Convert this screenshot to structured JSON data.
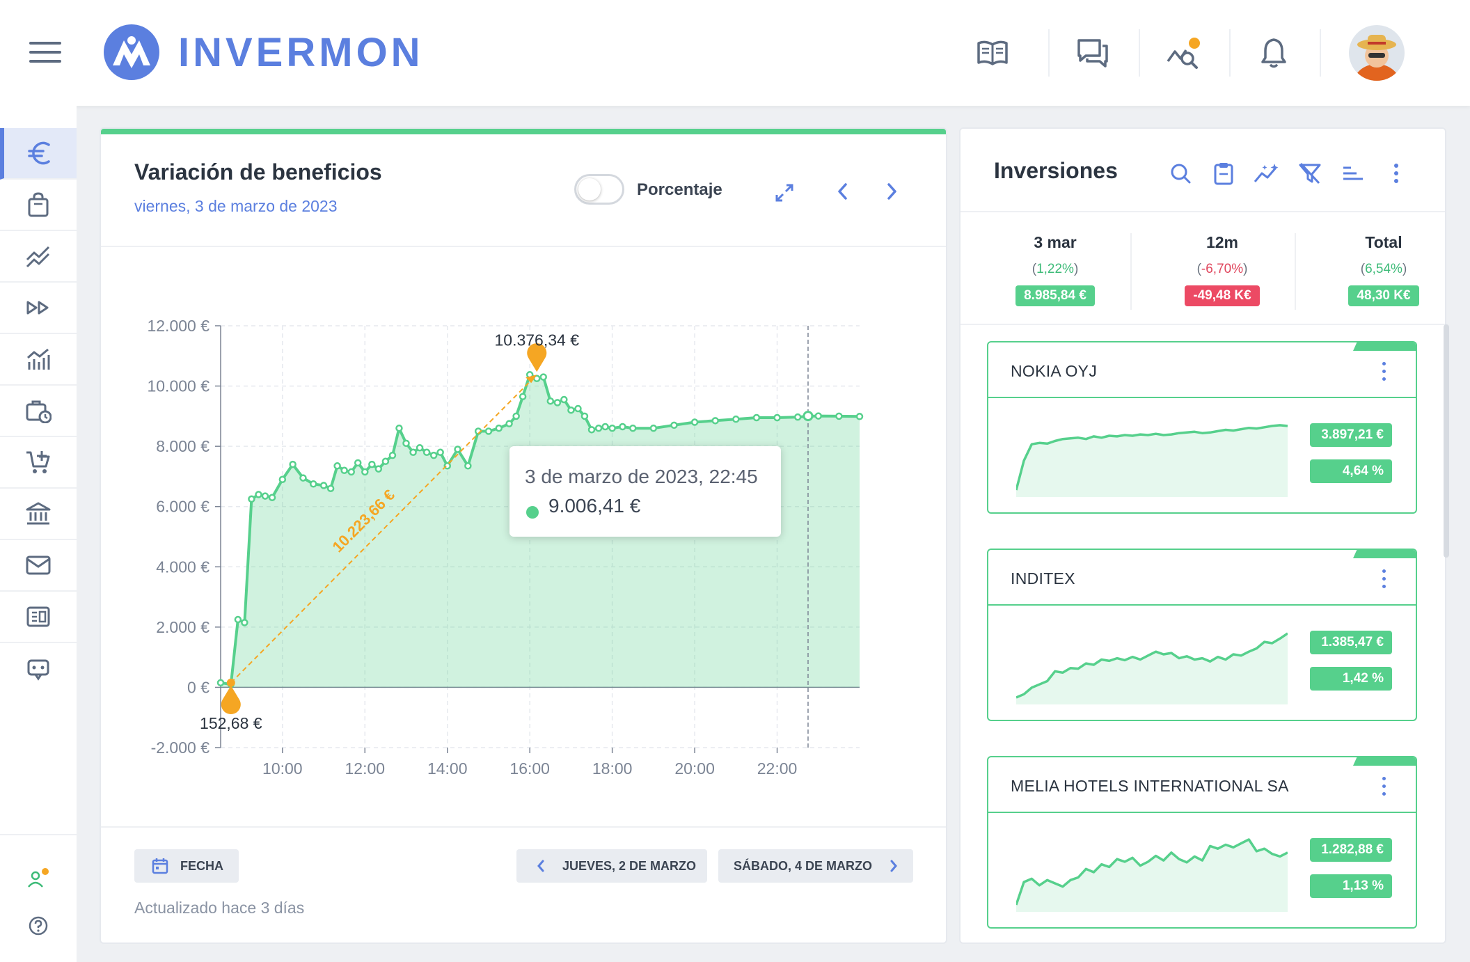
{
  "app": {
    "brand": "INVERMON",
    "header_icons": [
      "book-icon",
      "chat-icon",
      "analytics-icon",
      "bell-icon"
    ],
    "accent": "#5b7fdf",
    "positive": "#56d08c",
    "negative": "#ec4a64"
  },
  "sidebar": {
    "items": [
      "euro-icon",
      "bag-icon",
      "trend-icon",
      "fast-forward-icon",
      "bar-chart-icon",
      "portfolio-clock-icon",
      "cart-add-icon",
      "bank-icon",
      "mail-icon",
      "news-icon",
      "robot-icon"
    ],
    "bottom": [
      "user-status-icon",
      "help-icon"
    ]
  },
  "main": {
    "title": "Variación de beneficios",
    "subtitle": "viernes, 3 de marzo de 2023",
    "toggle_label": "Porcentaje",
    "tooltip": {
      "title": "3 de marzo de 2023, 22:45",
      "value": "9.006,41 €"
    },
    "annotations": {
      "max_label": "10.376,34 €",
      "min_label": "152,68 €",
      "delta_label": "10.223,66 €"
    },
    "date_button": "FECHA",
    "prev_day": "JUEVES, 2 DE MARZO",
    "next_day": "SÁBADO, 4 DE MARZO",
    "updated": "Actualizado hace 3 días"
  },
  "chart_data": {
    "type": "area",
    "title": "",
    "xlabel": "",
    "ylabel": "",
    "ylim": [
      -2000,
      12000
    ],
    "yticks": [
      "12.000 €",
      "10.000 €",
      "8.000 €",
      "6.000 €",
      "4.000 €",
      "2.000 €",
      "0 €",
      "-2.000 €"
    ],
    "ytick_values": [
      12000,
      10000,
      8000,
      6000,
      4000,
      2000,
      0,
      -2000
    ],
    "xticks": [
      "10:00",
      "12:00",
      "14:00",
      "16:00",
      "18:00",
      "20:00",
      "22:00"
    ],
    "xtick_hours": [
      10,
      12,
      14,
      16,
      18,
      20,
      22
    ],
    "xlim_hours": [
      8.5,
      24
    ],
    "grid": true,
    "series": [
      {
        "x": [
          8.5,
          8.75,
          8.92,
          9.08,
          9.25,
          9.42,
          9.58,
          9.75,
          10.0,
          10.25,
          10.5,
          10.75,
          11.0,
          11.17,
          11.33,
          11.5,
          11.67,
          11.83,
          12.0,
          12.17,
          12.33,
          12.5,
          12.67,
          12.83,
          13.0,
          13.17,
          13.33,
          13.5,
          13.67,
          13.83,
          14.0,
          14.25,
          14.5,
          14.75,
          15.0,
          15.25,
          15.5,
          15.67,
          15.83,
          16.0,
          16.17,
          16.33,
          16.5,
          16.67,
          16.83,
          17.0,
          17.17,
          17.33,
          17.5,
          17.67,
          17.83,
          18.0,
          18.25,
          18.5,
          19.0,
          19.5,
          20.0,
          20.5,
          21.0,
          21.5,
          22.0,
          22.5,
          22.75,
          23.0,
          23.5,
          24.0
        ],
        "y": [
          152.68,
          100,
          2250,
          2150,
          6250,
          6400,
          6350,
          6300,
          6900,
          7400,
          6950,
          6750,
          6700,
          6600,
          7350,
          7200,
          7150,
          7450,
          7150,
          7400,
          7250,
          7500,
          7700,
          8600,
          8100,
          7800,
          7950,
          7800,
          7700,
          7800,
          7350,
          7900,
          7350,
          8500,
          8500,
          8600,
          8750,
          9000,
          9650,
          10376.34,
          10250,
          10300,
          9500,
          9450,
          9550,
          9200,
          9250,
          9000,
          8550,
          8600,
          8650,
          8600,
          8650,
          8600,
          8600,
          8700,
          8800,
          8850,
          8900,
          8950,
          8950,
          8970,
          9000,
          9006.41,
          9000,
          8990
        ]
      }
    ],
    "markers": {
      "max": {
        "x": 16.17,
        "y": 10376.34
      },
      "min": {
        "x": 8.75,
        "y": 152.68
      },
      "cursor_hour": 22.75
    }
  },
  "right": {
    "title": "Inversiones",
    "icons": [
      "search-icon",
      "clipboard-icon",
      "sparkle-chart-icon",
      "filter-off-icon",
      "sort-icon",
      "more-icon"
    ],
    "summary": [
      {
        "label": "3 mar",
        "pct": "1,22%",
        "pct_sign": "pos",
        "value": "8.985,84 €",
        "value_sign": "pos"
      },
      {
        "label": "12m",
        "pct": "-6,70%",
        "pct_sign": "neg",
        "value": "-49,48 K€",
        "value_sign": "neg"
      },
      {
        "label": "Total",
        "pct": "6,54%",
        "pct_sign": "pos",
        "value": "48,30 K€",
        "value_sign": "pos"
      }
    ],
    "stocks": [
      {
        "name": "NOKIA OYJ",
        "amount": "3.897,21 €",
        "percent": "4,64 %",
        "spark": [
          0.0,
          0.45,
          0.7,
          0.72,
          0.71,
          0.75,
          0.78,
          0.79,
          0.8,
          0.78,
          0.82,
          0.8,
          0.83,
          0.82,
          0.84,
          0.83,
          0.85,
          0.84,
          0.86,
          0.84,
          0.85,
          0.87,
          0.88,
          0.89,
          0.87,
          0.88,
          0.9,
          0.92,
          0.91,
          0.93,
          0.95,
          0.94,
          0.96,
          0.98,
          0.99,
          0.98
        ]
      },
      {
        "name": "INDITEX",
        "amount": "1.385,47 €",
        "percent": "1,42 %",
        "spark": [
          0.0,
          0.05,
          0.15,
          0.2,
          0.25,
          0.4,
          0.38,
          0.45,
          0.44,
          0.52,
          0.5,
          0.58,
          0.56,
          0.6,
          0.57,
          0.62,
          0.58,
          0.64,
          0.7,
          0.66,
          0.68,
          0.6,
          0.63,
          0.58,
          0.6,
          0.55,
          0.62,
          0.58,
          0.66,
          0.64,
          0.7,
          0.75,
          0.85,
          0.83,
          0.9,
          0.98
        ]
      },
      {
        "name": "MELIA HOTELS INTERNATIONAL SA",
        "amount": "1.282,88 €",
        "percent": "1,13 %",
        "spark": [
          0.0,
          0.35,
          0.4,
          0.3,
          0.38,
          0.33,
          0.28,
          0.38,
          0.42,
          0.55,
          0.5,
          0.62,
          0.58,
          0.7,
          0.66,
          0.72,
          0.6,
          0.66,
          0.75,
          0.68,
          0.8,
          0.7,
          0.65,
          0.74,
          0.68,
          0.9,
          0.86,
          0.92,
          0.88,
          0.94,
          1.0,
          0.82,
          0.86,
          0.78,
          0.74,
          0.8
        ]
      }
    ]
  }
}
